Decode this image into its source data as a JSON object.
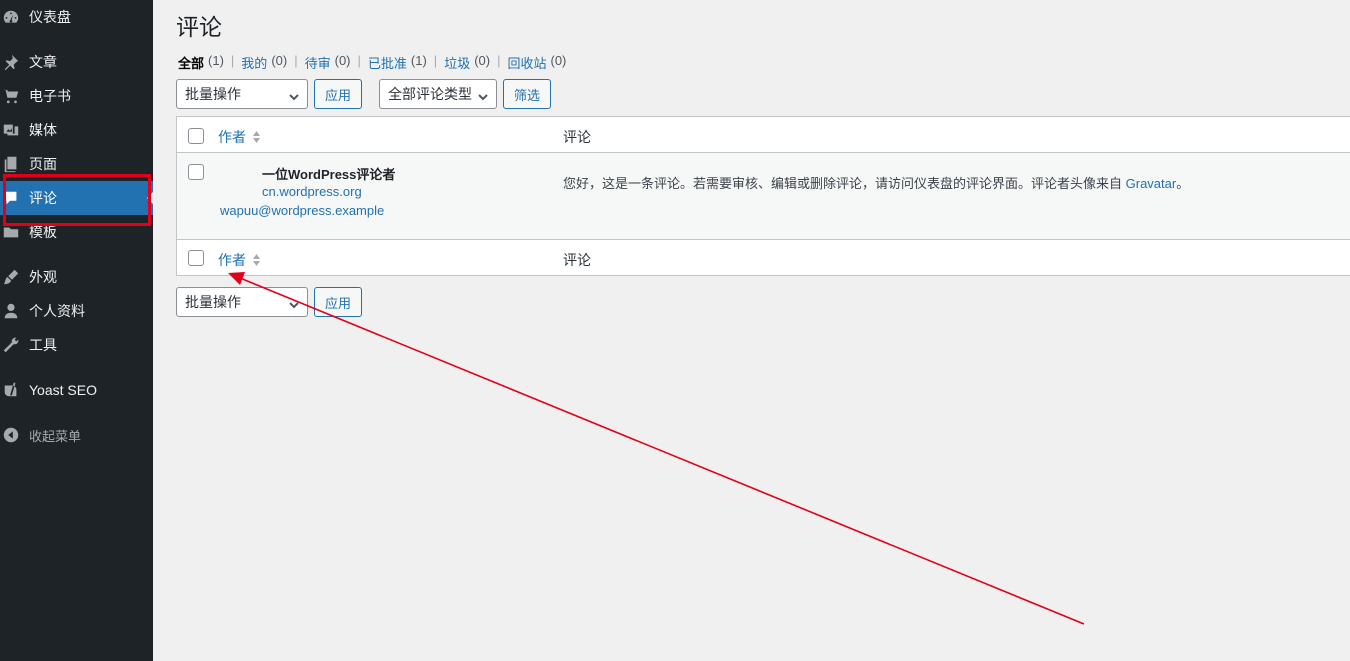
{
  "sidebar": {
    "items": [
      {
        "id": "dashboard",
        "label": "仪表盘",
        "icon": "dashboard-icon"
      },
      {
        "id": "posts",
        "label": "文章",
        "icon": "pin-icon"
      },
      {
        "id": "ebooks",
        "label": "电子书",
        "icon": "cart-icon"
      },
      {
        "id": "media",
        "label": "媒体",
        "icon": "media-icon"
      },
      {
        "id": "pages",
        "label": "页面",
        "icon": "page-icon"
      },
      {
        "id": "comments",
        "label": "评论",
        "icon": "comment-icon",
        "current": true
      },
      {
        "id": "templates",
        "label": "模板",
        "icon": "folder-icon"
      },
      {
        "id": "appearance",
        "label": "外观",
        "icon": "brush-icon"
      },
      {
        "id": "profile",
        "label": "个人资料",
        "icon": "user-icon"
      },
      {
        "id": "tools",
        "label": "工具",
        "icon": "wrench-icon"
      },
      {
        "id": "yoast",
        "label": "Yoast SEO",
        "icon": "yoast-icon"
      },
      {
        "id": "collapse",
        "label": "收起菜单",
        "icon": "collapse-icon"
      }
    ]
  },
  "page": {
    "title": "评论"
  },
  "filters": [
    {
      "label": "全部",
      "count": "(1)",
      "current": true
    },
    {
      "label": "我的",
      "count": "(0)"
    },
    {
      "label": "待审",
      "count": "(0)"
    },
    {
      "label": "已批准",
      "count": "(1)"
    },
    {
      "label": "垃圾",
      "count": "(0)"
    },
    {
      "label": "回收站",
      "count": "(0)"
    }
  ],
  "toolbar": {
    "bulk_action": "批量操作",
    "apply": "应用",
    "comment_type": "全部评论类型",
    "filter": "筛选"
  },
  "table": {
    "col_author": "作者",
    "col_comment": "评论",
    "rows": [
      {
        "author_name": "一位WordPress评论者",
        "author_url": "cn.wordpress.org",
        "author_email": "wapuu@wordpress.example",
        "comment": "您好，这是一条评论。若需要审核、编辑或删除评论，请访问仪表盘的评论界面。评论者头像来自 ",
        "comment_link": "Gravatar",
        "comment_end": "。"
      }
    ]
  },
  "colors": {
    "sidebar_bg": "#1d2327",
    "accent": "#2271b1",
    "annotation": "#e1001a"
  }
}
